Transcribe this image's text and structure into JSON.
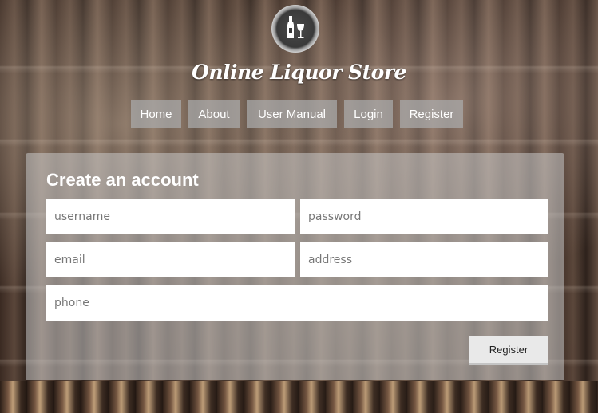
{
  "site": {
    "title": "Online Liquor Store",
    "logo_icon": "wine-bottle-glass-icon"
  },
  "nav": {
    "items": [
      {
        "label": "Home"
      },
      {
        "label": "About"
      },
      {
        "label": "User Manual"
      },
      {
        "label": "Login"
      },
      {
        "label": "Register"
      }
    ]
  },
  "form": {
    "heading": "Create an account",
    "fields": {
      "username": {
        "placeholder": "username",
        "value": ""
      },
      "password": {
        "placeholder": "password",
        "value": ""
      },
      "email": {
        "placeholder": "email",
        "value": ""
      },
      "address": {
        "placeholder": "address",
        "value": ""
      },
      "phone": {
        "placeholder": "phone",
        "value": ""
      }
    },
    "submit_label": "Register"
  },
  "colors": {
    "nav_button_bg": "#aaaaaa",
    "panel_bg": "#c8c8c8",
    "text_light": "#ffffff"
  }
}
